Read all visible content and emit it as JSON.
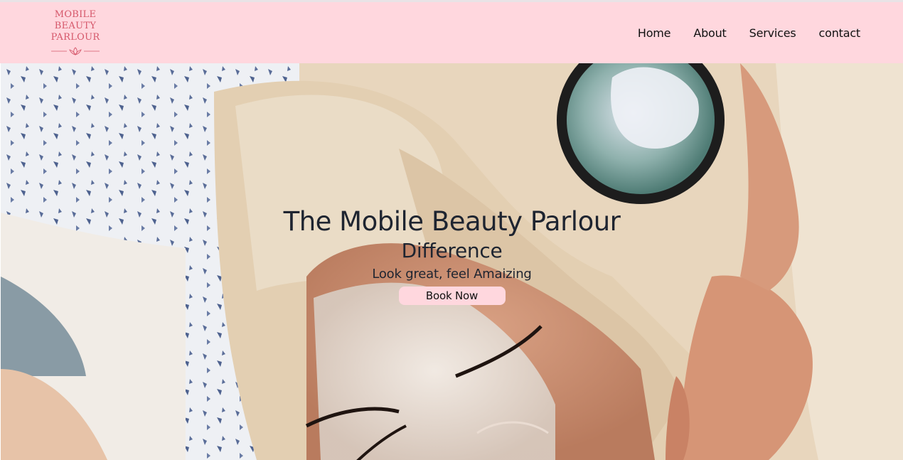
{
  "brand": {
    "logo_lines": [
      "MOBILE",
      "BEAUTY",
      "PARLOUR"
    ],
    "logo_icon": "lotus-icon",
    "color": "#d5576a"
  },
  "nav": {
    "items": [
      {
        "label": "Home"
      },
      {
        "label": "About"
      },
      {
        "label": "Services"
      },
      {
        "label": "contact"
      }
    ],
    "background": "#ffd7de"
  },
  "hero": {
    "title": "The Mobile Beauty Parlour",
    "title_line2": "Difference",
    "subtitle": "Look great, feel Amaizing",
    "cta_label": "Book Now",
    "cta_color": "#ffd7de"
  }
}
